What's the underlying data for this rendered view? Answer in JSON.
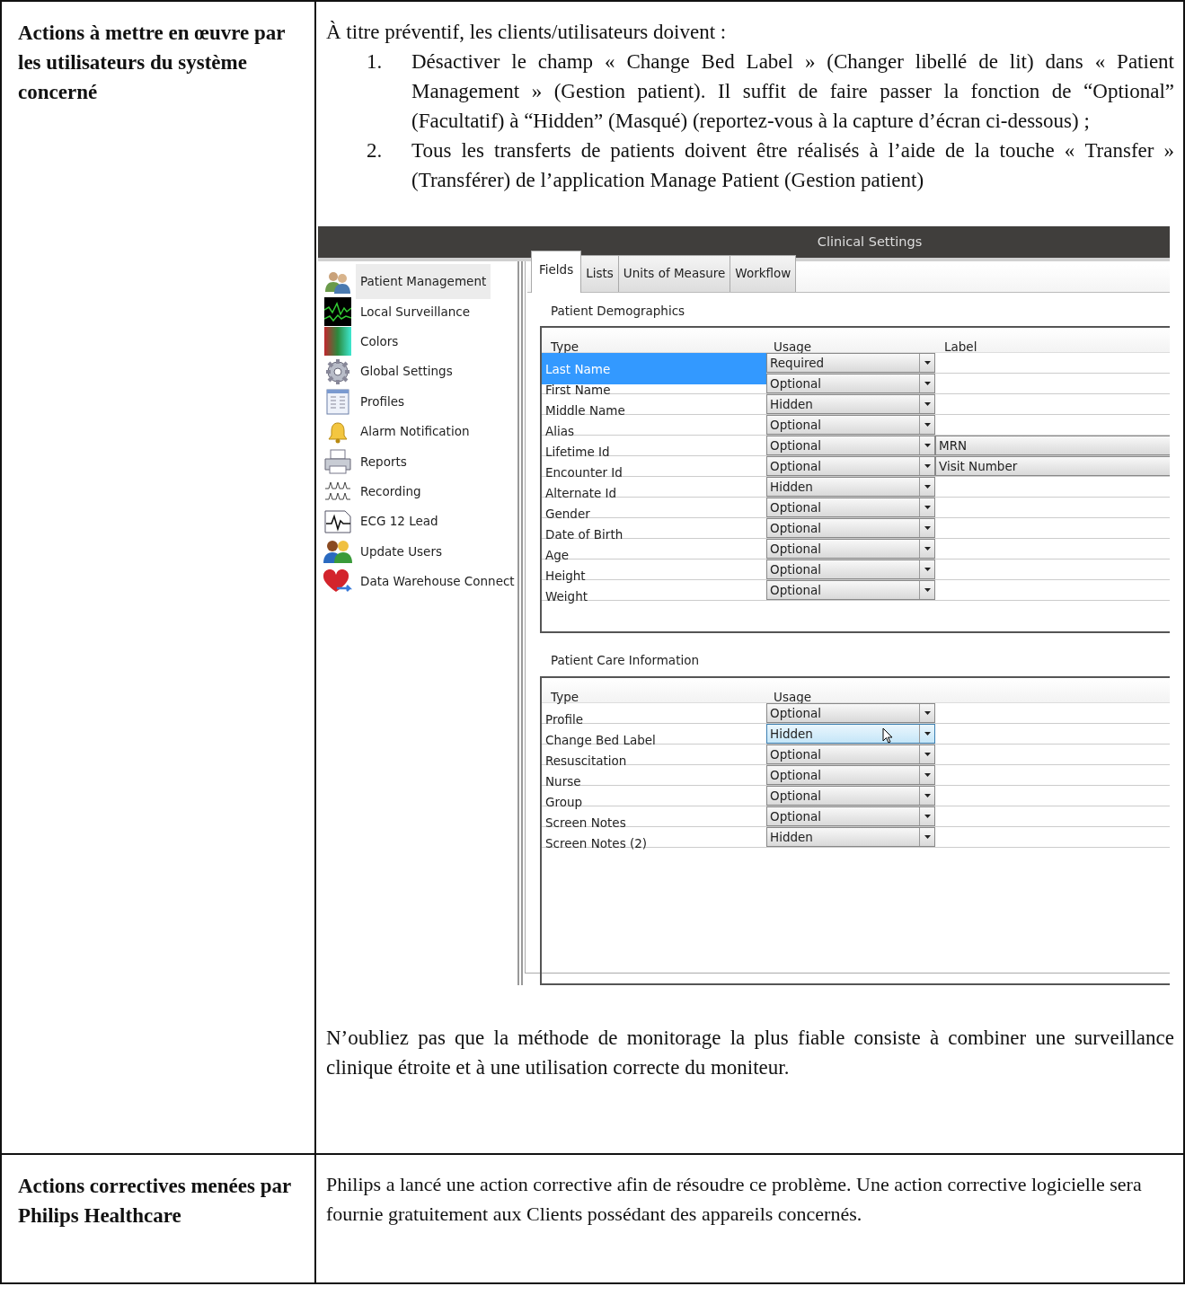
{
  "sections": [
    {
      "heading": "Actions à mettre en œuvre par les utilisateurs du système concerné",
      "intro": "À titre préventif, les clients/utilisateurs doivent :",
      "steps": [
        {
          "number": "1.",
          "text": "Désactiver le champ « Change Bed Label » (Changer libellé de lit) dans « Patient Management » (Gestion patient).  Il suffit de faire passer la fonction de “Optional” (Facultatif) à “Hidden” (Masqué) (reportez-vous à la capture d’écran ci-dessous) ;"
        },
        {
          "number": "2.",
          "text": "Tous les transferts de patients doivent être réalisés à l’aide de la touche « Transfer » (Transférer) de l’application Manage Patient (Gestion patient)"
        }
      ],
      "screenshot": {
        "title": "Clinical Settings",
        "nav": [
          {
            "label": "Patient Management",
            "selected": true
          },
          {
            "label": "Local Surveillance",
            "selected": false
          },
          {
            "label": "Colors",
            "selected": false
          },
          {
            "label": "Global Settings",
            "selected": false
          },
          {
            "label": "Profiles",
            "selected": false
          },
          {
            "label": "Alarm Notification",
            "selected": false
          },
          {
            "label": "Reports",
            "selected": false
          },
          {
            "label": "Recording",
            "selected": false
          },
          {
            "label": "ECG 12 Lead",
            "selected": false
          },
          {
            "label": "Update Users",
            "selected": false
          },
          {
            "label": "Data Warehouse Connect",
            "selected": false
          }
        ],
        "tabs": [
          {
            "label": "Fields",
            "selected": true
          },
          {
            "label": "Lists",
            "selected": false
          },
          {
            "label": "Units of Measure",
            "selected": false
          },
          {
            "label": "Workflow",
            "selected": false
          }
        ],
        "groups": [
          {
            "title": "Patient Demographics",
            "columns": [
              "Type",
              "Usage",
              "Label"
            ],
            "rows": [
              {
                "type": "Last Name",
                "usage": "Required",
                "selected": true,
                "focused": false
              },
              {
                "type": "First Name",
                "usage": "Optional",
                "selected": false,
                "focused": false
              },
              {
                "type": "Middle Name",
                "usage": "Hidden",
                "selected": false,
                "focused": false
              },
              {
                "type": "Alias",
                "usage": "Optional",
                "selected": false,
                "focused": false
              },
              {
                "type": "Lifetime Id",
                "usage": "Optional",
                "label": "MRN",
                "selected": false,
                "focused": false
              },
              {
                "type": "Encounter Id",
                "usage": "Optional",
                "label": "Visit Number",
                "selected": false,
                "focused": false
              },
              {
                "type": "Alternate Id",
                "usage": "Hidden",
                "selected": false,
                "focused": false
              },
              {
                "type": "Gender",
                "usage": "Optional",
                "selected": false,
                "focused": false
              },
              {
                "type": "Date of Birth",
                "usage": "Optional",
                "selected": false,
                "focused": false
              },
              {
                "type": "Age",
                "usage": "Optional",
                "selected": false,
                "focused": false
              },
              {
                "type": "Height",
                "usage": "Optional",
                "selected": false,
                "focused": false
              },
              {
                "type": "Weight",
                "usage": "Optional",
                "selected": false,
                "focused": false
              }
            ]
          },
          {
            "title": "Patient Care Information",
            "columns": [
              "Type",
              "Usage"
            ],
            "rows": [
              {
                "type": "Profile",
                "usage": "Optional",
                "selected": false,
                "focused": false
              },
              {
                "type": "Change Bed Label",
                "usage": "Hidden",
                "selected": false,
                "focused": true
              },
              {
                "type": "Resuscitation",
                "usage": "Optional",
                "selected": false,
                "focused": false
              },
              {
                "type": "Nurse",
                "usage": "Optional",
                "selected": false,
                "focused": false
              },
              {
                "type": "Group",
                "usage": "Optional",
                "selected": false,
                "focused": false
              },
              {
                "type": "Screen Notes",
                "usage": "Optional",
                "selected": false,
                "focused": false
              },
              {
                "type": "Screen Notes (2)",
                "usage": "Hidden",
                "selected": false,
                "focused": false
              }
            ]
          }
        ]
      },
      "note": "N’oubliez pas que la méthode de monitorage la plus fiable consiste à combiner une surveillance clinique étroite et à une utilisation correcte du moniteur."
    },
    {
      "heading": "Actions correctives menées par Philips Healthcare",
      "body": "Philips a lancé une action corrective afin de résoudre ce problème. Une action corrective logicielle sera fournie gratuitement aux Clients possédant des appareils concernés."
    }
  ]
}
